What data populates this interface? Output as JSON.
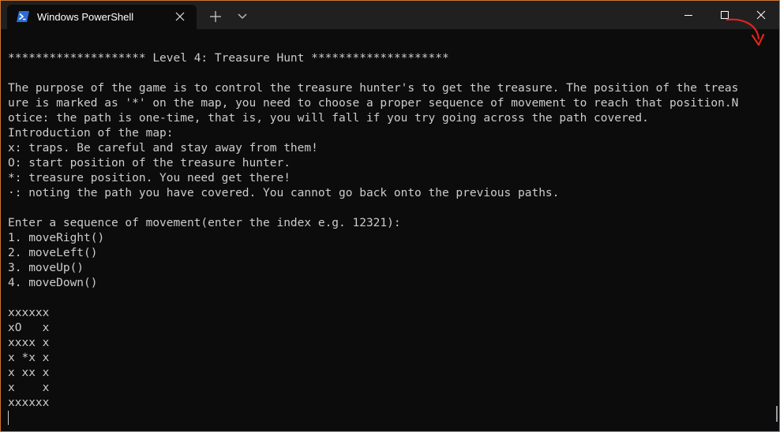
{
  "titlebar": {
    "tab_title": "Windows PowerShell"
  },
  "terminal": {
    "lines": [
      "******************** Level 4: Treasure Hunt ********************",
      "",
      "The purpose of the game is to control the treasure hunter's to get the treasure. The position of the treas",
      "ure is marked as '*' on the map, you need to choose a proper sequence of movement to reach that position.N",
      "otice: the path is one-time, that is, you will fall if you try going across the path covered.",
      "Introduction of the map:",
      "x: traps. Be careful and stay away from them!",
      "O: start position of the treasure hunter.",
      "*: treasure position. You need get there!",
      "·: noting the path you have covered. You cannot go back onto the previous paths.",
      "",
      "Enter a sequence of movement(enter the index e.g. 12321):",
      "1. moveRight()",
      "2. moveLeft()",
      "3. moveUp()",
      "4. moveDown()",
      "",
      "xxxxxx",
      "xO   x",
      "xxxx x",
      "x *x x",
      "x xx x",
      "x    x",
      "xxxxxx"
    ]
  },
  "colors": {
    "background": "#0c0c0c",
    "titlebar": "#202020",
    "text": "#cccccc",
    "window_border": "#d0762f",
    "annotation_arrow": "#e0241b",
    "powershell_icon": "#2b6dd8"
  },
  "icons": {
    "tab_icon": "powershell-icon",
    "tab_close": "close-icon",
    "new_tab": "plus-icon",
    "dropdown": "chevron-down-icon",
    "minimize": "minimize-icon",
    "maximize": "maximize-icon",
    "close": "close-icon",
    "annotation": "red-arrow-icon"
  }
}
